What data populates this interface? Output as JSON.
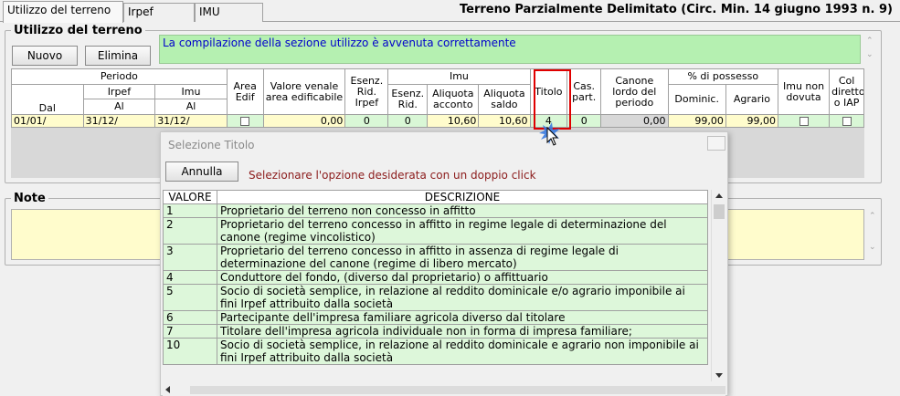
{
  "tabs": [
    "Utilizzo del terreno",
    "Irpef",
    "IMU"
  ],
  "header_title": "Terreno Parzialmente Delimitato (Circ. Min. 14 giugno 1993 n. 9)",
  "utilizzo": {
    "title": "Utilizzo del terreno",
    "new_button": "Nuovo",
    "delete_button": "Elimina",
    "message": "La compilazione della sezione utilizzo è avvenuta correttamente"
  },
  "grid": {
    "h_periodo": "Periodo",
    "h_irpef": "Irpef",
    "h_imu": "Imu",
    "h_dal": "Dal",
    "h_al_irpef": "Al",
    "h_al_imu": "Al",
    "h_area_edif": "Area Edif",
    "h_valore_venale": "Valore venale area edificabile",
    "h_esenz_rid_irpef": "Esenz. Rid. Irpef",
    "h_imu_group": "Imu",
    "h_esenz_rid": "Esenz. Rid.",
    "h_aliquota_acconto": "Aliquota acconto",
    "h_aliquota_saldo": "Aliquota saldo",
    "h_titolo": "Titolo",
    "h_cas_part": "Cas. part.",
    "h_canone": "Canone lordo del periodo",
    "h_possesso": "% di possesso",
    "h_dominic": "Dominic.",
    "h_agrario": "Agrario",
    "h_imu_non_dovuta": "Imu non dovuta",
    "h_col_diretto": "Col diretto o IAP",
    "row": {
      "dal": "01/01/",
      "al_irpef": "31/12/",
      "al_imu": "31/12/",
      "valore": "0,00",
      "esenz_irpef": "0",
      "esenz_rid": "0",
      "acconto": "10,60",
      "saldo": "10,60",
      "titolo": "4",
      "cas_part": "0",
      "canone": "0,00",
      "dominic": "99,00",
      "agrario": "99,00"
    }
  },
  "note": {
    "title": "Note"
  },
  "dialog": {
    "title": "Selezione Titolo",
    "cancel_button": "Annulla",
    "message": "Selezionare l'opzione desiderata con un doppio click",
    "col_valore": "VALORE",
    "col_descrizione": "DESCRIZIONE",
    "rows": [
      {
        "valore": "1",
        "descrizione": "Proprietario del terreno non concesso in affitto"
      },
      {
        "valore": "2",
        "descrizione": "Proprietario del terreno concesso in affitto in regime legale di determinazione del canone (regime vincolistico)"
      },
      {
        "valore": "3",
        "descrizione": "Proprietario del terreno concesso in affitto in assenza di regime legale di determinazione del canone (regime di libero mercato)"
      },
      {
        "valore": "4",
        "descrizione": "Conduttore del fondo, (diverso dal proprietario) o affittuario"
      },
      {
        "valore": "5",
        "descrizione": "Socio di società semplice, in relazione al reddito dominicale e/o agrario imponibile ai fini Irpef attribuito dalla società"
      },
      {
        "valore": "6",
        "descrizione": "Partecipante dell'impresa familiare agricola diverso dal titolare"
      },
      {
        "valore": "7",
        "descrizione": "Titolare dell'impresa agricola individuale non in forma di impresa familiare;"
      },
      {
        "valore": "10",
        "descrizione": "Socio di società semplice, in relazione al reddito dominicale e agrario non imponibile ai fini Irpef attribuito dalla società"
      }
    ]
  }
}
